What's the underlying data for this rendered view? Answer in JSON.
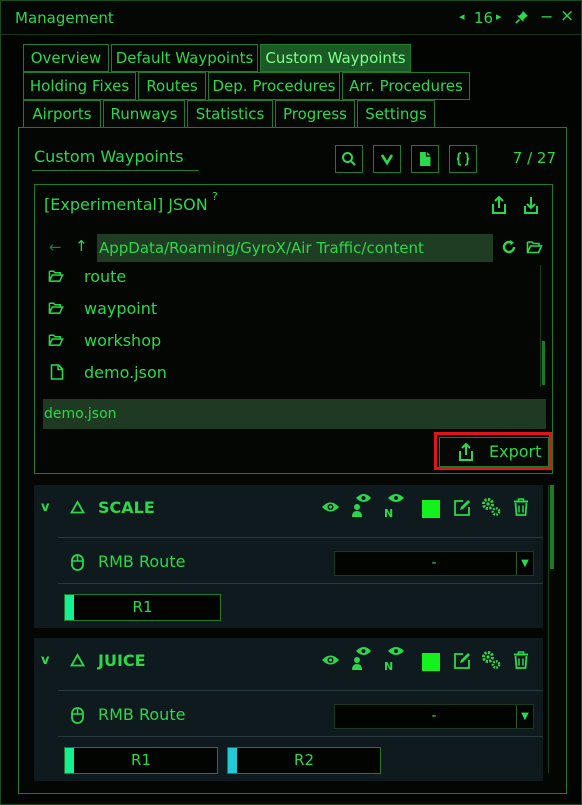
{
  "window": {
    "title": "Management",
    "page_number": "16",
    "controls": {
      "prev": "◂",
      "next": "▸",
      "minimize": "−",
      "close": "×"
    }
  },
  "tabs": {
    "row1": [
      "Overview",
      "Default Waypoints",
      "Custom Waypoints"
    ],
    "row2": [
      "Holding Fixes",
      "Routes",
      "Dep. Procedures",
      "Arr. Procedures"
    ],
    "row3": [
      "Airports",
      "Runways",
      "Statistics",
      "Progress",
      "Settings"
    ],
    "active": "Custom Waypoints"
  },
  "section": {
    "title": "Custom Waypoints",
    "counter": "7 / 27",
    "tool_icons": [
      "search-icon",
      "chevron-down-icon",
      "file-icon",
      "braces-icon"
    ]
  },
  "json_panel": {
    "title": "[Experimental] JSON",
    "help": "?",
    "path": "AppData/Roaming/GyroX/Air Traffic/content",
    "back": "←",
    "up": "↑",
    "entries": [
      {
        "name": "route",
        "type": "folder"
      },
      {
        "name": "waypoint",
        "type": "folder"
      },
      {
        "name": "workshop",
        "type": "folder"
      },
      {
        "name": "demo.json",
        "type": "file"
      }
    ],
    "filename": "demo.json",
    "export_label": "Export"
  },
  "cards": [
    {
      "name": "SCALE",
      "collapse": "v",
      "n_label": "N",
      "rmb_label": "RMB Route",
      "rmb_value": "-",
      "routes": [
        {
          "label": "R1",
          "color": "#13f094"
        }
      ]
    },
    {
      "name": "JUICE",
      "collapse": "v",
      "n_label": "N",
      "rmb_label": "RMB Route",
      "rmb_value": "-",
      "routes": [
        {
          "label": "R1",
          "color": "#13f094"
        },
        {
          "label": "R2",
          "color": "#22c9d6"
        }
      ]
    }
  ],
  "colors": {
    "accent": "#2bd84a",
    "active_tab": "#1c5a25",
    "highlight_red": "#e0141a",
    "status_green": "#13f21c"
  }
}
